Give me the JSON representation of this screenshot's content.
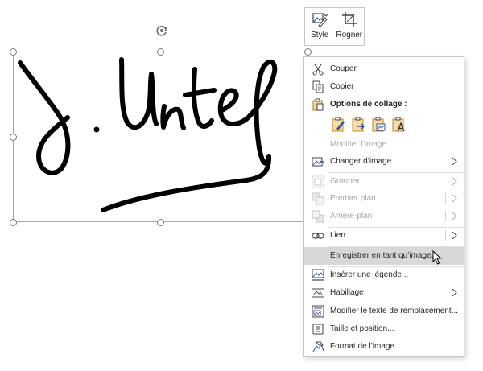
{
  "toolbar": {
    "style_label": "Style",
    "crop_label": "Rogner"
  },
  "menu": {
    "cut": "Couper",
    "copy": "Copier",
    "paste_options": "Options de collage :",
    "edit_image": "Modifier l’image",
    "change_image": "Changer d’image",
    "group": "Grouper",
    "bring_forward": "Premier plan",
    "send_backward": "Arrière-plan",
    "link": "Lien",
    "save_as_image": "Enregistrer en tant qu’image...",
    "insert_caption": "Insérer une légende...",
    "wrap_text": "Habillage",
    "edit_alt_text": "Modifier le texte de remplacement...",
    "size_position": "Taille et position...",
    "format_image": "Format de l’image..."
  },
  "colors": {
    "accent_blue": "#2b579a",
    "paste_orange": "#d08b1c",
    "hover_gray": "#d8d8d8",
    "disabled_text": "#a6a6a6"
  },
  "icons": {
    "style": "picture-style-icon",
    "crop": "crop-icon",
    "cut": "scissors-icon",
    "copy": "copy-icon",
    "paste": "clipboard-icon",
    "change_image": "change-picture-icon",
    "group": "group-icon",
    "bring_forward": "bring-forward-icon",
    "send_backward": "send-backward-icon",
    "link": "link-icon",
    "insert_caption": "caption-icon",
    "wrap_text": "wrap-text-icon",
    "alt_text": "alt-text-icon",
    "size_position": "size-position-icon",
    "format_image": "format-picture-icon"
  }
}
